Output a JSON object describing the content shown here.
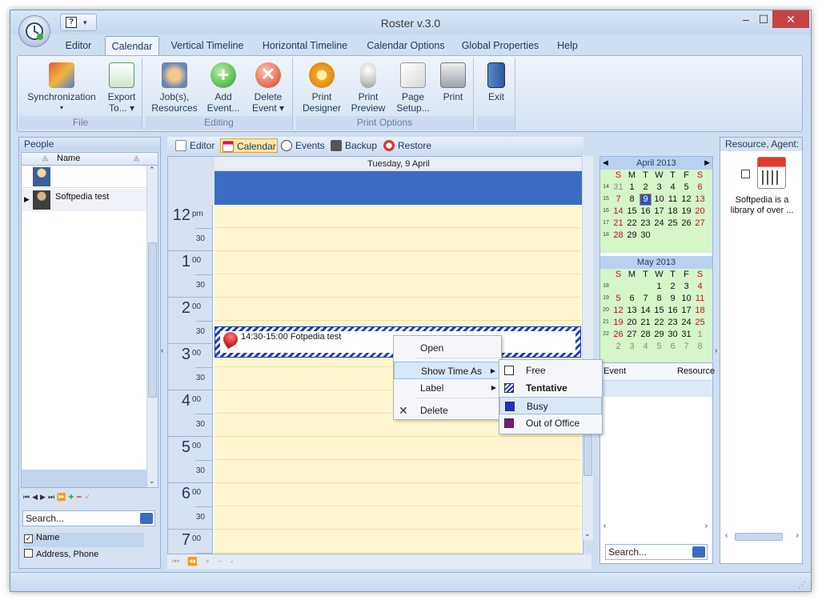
{
  "window": {
    "title": "Roster v.3.0"
  },
  "tabs": [
    "Editor",
    "Calendar",
    "Vertical Timeline",
    "Horizontal Timeline",
    "Calendar Options",
    "Global Properties",
    "Help"
  ],
  "ribbon": {
    "groups": {
      "file": "File",
      "editing": "Editing",
      "print": "Print Options"
    },
    "buttons": {
      "sync": "Synchronization",
      "export1": "Export",
      "export2": "To...",
      "jobs1": "Job(s),",
      "jobs2": "Resources",
      "add1": "Add",
      "add2": "Event...",
      "del1": "Delete",
      "del2": "Event",
      "pd1": "Print",
      "pd2": "Designer",
      "pp1": "Print",
      "pp2": "Preview",
      "ps1": "Page",
      "ps2": "Setup...",
      "print": "Print",
      "exit": "Exit"
    }
  },
  "people": {
    "title": "People",
    "column": "Name",
    "rows": [
      "",
      "Softpedia test"
    ],
    "search_placeholder": "Search...",
    "filters": [
      {
        "label": "Name",
        "checked": true
      },
      {
        "label": "Address, Phone",
        "checked": false
      }
    ]
  },
  "viewbar": [
    "Editor",
    "Calendar",
    "Events",
    "Backup",
    "Restore"
  ],
  "schedule": {
    "day_header": "Tuesday, 9 April",
    "hours": [
      {
        "h": "12",
        "m": "pm"
      },
      {
        "h": "1",
        "m": "00"
      },
      {
        "h": "2",
        "m": "00"
      },
      {
        "h": "3",
        "m": "00"
      },
      {
        "h": "4",
        "m": "00"
      },
      {
        "h": "5",
        "m": "00"
      },
      {
        "h": "6",
        "m": "00"
      },
      {
        "h": "7",
        "m": "00"
      }
    ],
    "half": "30",
    "event": "14:30-15:00 Fotpedia test"
  },
  "context_menu": {
    "open": "Open",
    "show_time_as": "Show Time As",
    "label": "Label",
    "delete": "Delete"
  },
  "submenu": {
    "free": "Free",
    "tentative": "Tentative",
    "busy": "Busy",
    "out": "Out of Office",
    "colors": {
      "free": "#ffffff",
      "busy": "#1f2fd6",
      "out": "#7a1a78"
    }
  },
  "mini_calendars": [
    {
      "title": "April 2013",
      "weekdays": [
        "S",
        "M",
        "T",
        "W",
        "T",
        "F",
        "S"
      ],
      "weeks": [
        "14",
        "15",
        "16",
        "17",
        "18"
      ],
      "days": [
        [
          "31",
          "1",
          "2",
          "3",
          "4",
          "5",
          "6"
        ],
        [
          "7",
          "8",
          "9",
          "10",
          "11",
          "12",
          "13"
        ],
        [
          "14",
          "15",
          "16",
          "17",
          "18",
          "19",
          "20"
        ],
        [
          "21",
          "22",
          "23",
          "24",
          "25",
          "26",
          "27"
        ],
        [
          "28",
          "29",
          "30",
          "",
          "",
          "",
          ""
        ]
      ],
      "selected": "9"
    },
    {
      "title": "May 2013",
      "weekdays": [
        "S",
        "M",
        "T",
        "W",
        "T",
        "F",
        "S"
      ],
      "weeks": [
        "18",
        "19",
        "20",
        "21",
        "22"
      ],
      "days": [
        [
          "",
          "",
          "",
          "1",
          "2",
          "3",
          "4"
        ],
        [
          "5",
          "6",
          "7",
          "8",
          "9",
          "10",
          "11"
        ],
        [
          "12",
          "13",
          "14",
          "15",
          "16",
          "17",
          "18"
        ],
        [
          "19",
          "20",
          "21",
          "22",
          "23",
          "24",
          "25"
        ],
        [
          "26",
          "27",
          "28",
          "29",
          "30",
          "31",
          "1"
        ],
        [
          "2",
          "3",
          "4",
          "5",
          "6",
          "7",
          "8"
        ]
      ]
    }
  ],
  "events_grid": {
    "columns": [
      "Event",
      "Resource"
    ],
    "search_placeholder": "Search..."
  },
  "resource_panel": {
    "title": "Resource, Agent:",
    "label": "Softpedia is a library of over ..."
  }
}
